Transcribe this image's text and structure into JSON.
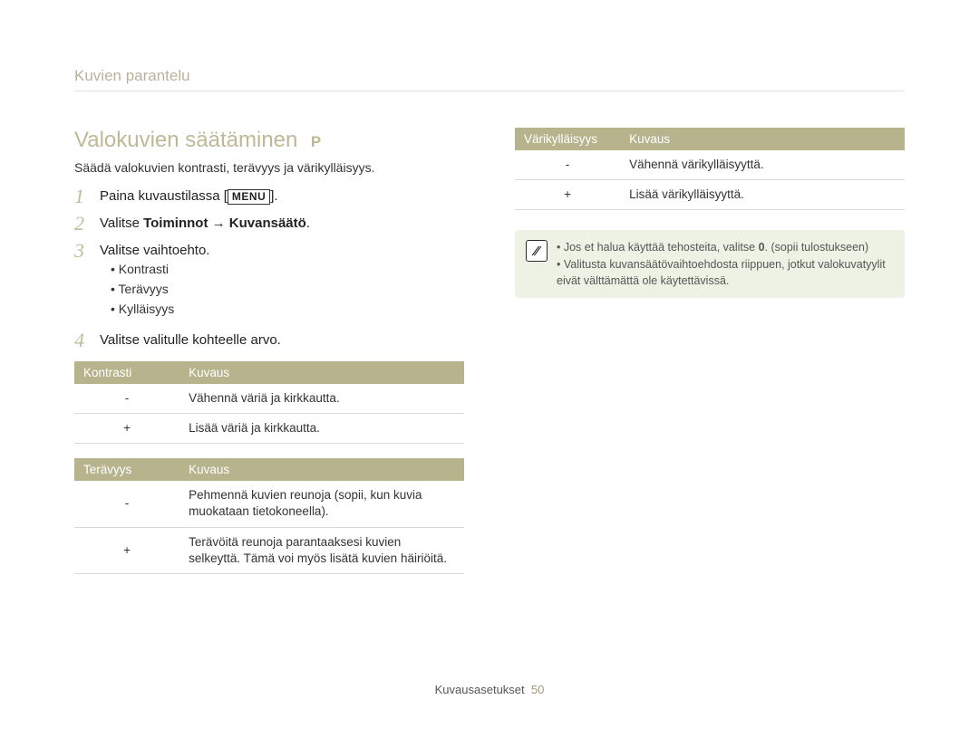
{
  "breadcrumb": "Kuvien parantelu",
  "section": {
    "title": "Valokuvien säätäminen",
    "mode": "P"
  },
  "lead": "Säädä valokuvien kontrasti, terävyys ja värikylläisyys.",
  "steps": {
    "n1": "1",
    "s1_pre": "Paina kuvaustilassa [",
    "s1_menu": "MENU",
    "s1_post": "].",
    "n2": "2",
    "s2_pre": "Valitse ",
    "s2_bold": "Toiminnot → Kuvansäätö",
    "s2_post": ".",
    "n3": "3",
    "s3": "Valitse vaihtoehto.",
    "n4": "4",
    "s4": "Valitse valitulle kohteelle arvo."
  },
  "bullets": {
    "a": "Kontrasti",
    "b": "Terävyys",
    "c": "Kylläisyys"
  },
  "table_contrast": {
    "h1": "Kontrasti",
    "h2": "Kuvaus",
    "r1c1": "-",
    "r1c2": "Vähennä väriä ja kirkkautta.",
    "r2c1": "+",
    "r2c2": "Lisää väriä ja kirkkautta."
  },
  "table_sharpness": {
    "h1": "Terävyys",
    "h2": "Kuvaus",
    "r1c1": "-",
    "r1c2": "Pehmennä kuvien reunoja (sopii, kun kuvia muokataan tietokoneella).",
    "r2c1": "+",
    "r2c2": "Terävöitä reunoja parantaaksesi kuvien selkeyttä. Tämä voi myös lisätä kuvien häiriöitä."
  },
  "table_saturation": {
    "h1": "Värikylläisyys",
    "h2": "Kuvaus",
    "r1c1": "-",
    "r1c2": "Vähennä värikylläisyyttä.",
    "r2c1": "+",
    "r2c2": "Lisää värikylläisyyttä."
  },
  "note": {
    "a_pre": "Jos et halua käyttää tehosteita, valitse ",
    "a_bold": "0",
    "a_post": ". (sopii tulostukseen)",
    "b": "Valitusta kuvansäätövaihtoehdosta riippuen, jotkut valokuvatyylit eivät välttämättä ole käytettävissä."
  },
  "footer": {
    "label": "Kuvausasetukset",
    "page": "50"
  }
}
